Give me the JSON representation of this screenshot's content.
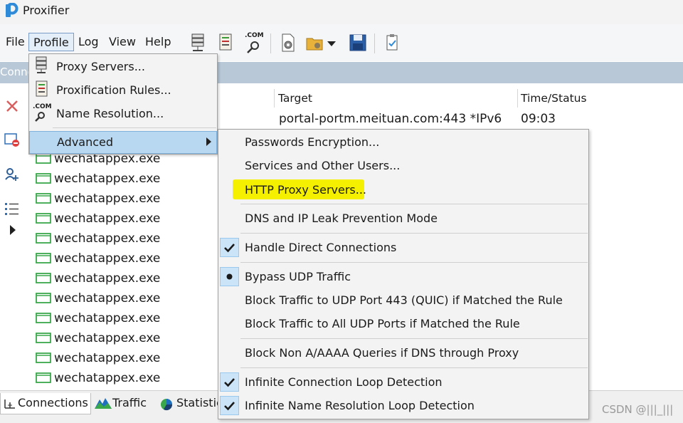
{
  "window": {
    "title": "Proxifier"
  },
  "menubar": {
    "items": [
      "File",
      "Profile",
      "Log",
      "View",
      "Help"
    ]
  },
  "toolbar": {
    "com_label": ".COM"
  },
  "tabstrip": {
    "partial_label": "Conne"
  },
  "columns": {
    "target": "Target",
    "time_status": "Time/Status"
  },
  "first_row": {
    "target": "portal-portm.meituan.com:443 *IPv6",
    "time": "09:03"
  },
  "rows": [
    "wechatappex.exe",
    "wechatappex.exe",
    "wechatappex.exe",
    "wechatappex.exe",
    "wechatappex.exe",
    "wechatappex.exe",
    "wechatappex.exe",
    "wechatappex.exe",
    "wechatappex.exe",
    "wechatappex.exe",
    "wechatappex.exe",
    "wechatappex.exe"
  ],
  "profile_menu": {
    "items": [
      "Proxy Servers...",
      "Proxification Rules...",
      "Name Resolution...",
      "Advanced"
    ],
    "com_label": ".COM"
  },
  "advanced_menu": {
    "items": [
      {
        "label": "Passwords Encryption...",
        "state": "none"
      },
      {
        "label": "Services and Other Users...",
        "state": "none"
      },
      {
        "label": "HTTP Proxy Servers...",
        "state": "none",
        "highlighted": true
      },
      {
        "label": "DNS and IP Leak Prevention Mode",
        "state": "none"
      },
      {
        "label": "Handle Direct Connections",
        "state": "checked"
      },
      {
        "label": "Bypass UDP Traffic",
        "state": "radio"
      },
      {
        "label": "Block Traffic to UDP Port 443 (QUIC) if Matched the Rule",
        "state": "none"
      },
      {
        "label": "Block Traffic to All UDP Ports if Matched the Rule",
        "state": "none"
      },
      {
        "label": "Block Non A/AAAA Queries if DNS through Proxy",
        "state": "none"
      },
      {
        "label": "Infinite Connection Loop Detection",
        "state": "checked"
      },
      {
        "label": "Infinite Name Resolution Loop Detection",
        "state": "checked"
      }
    ],
    "highlight_color": "#f5f000"
  },
  "bottom_tabs": {
    "connections": "Connections",
    "traffic": "Traffic",
    "statistics": "Statistic"
  },
  "watermark": "CSDN @|||_|||",
  "colors": {
    "accent": "#2f8ad8",
    "menu_selected": "#b8d8f2",
    "check_bg": "#cce4f7"
  }
}
